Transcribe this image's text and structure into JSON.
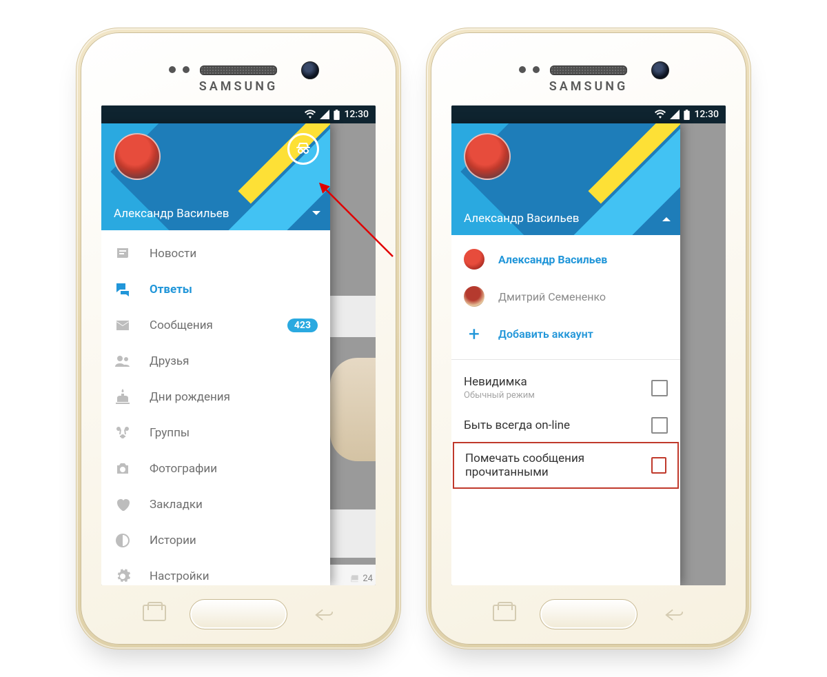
{
  "brand": "SAMSUNG",
  "status_time": "12:30",
  "user_name": "Александр Васильев",
  "nav": [
    {
      "key": "news",
      "label": "Новости"
    },
    {
      "key": "replies",
      "label": "Ответы"
    },
    {
      "key": "messages",
      "label": "Сообщения",
      "badge": "423"
    },
    {
      "key": "friends",
      "label": "Друзья"
    },
    {
      "key": "birthdays",
      "label": "Дни рождения"
    },
    {
      "key": "groups",
      "label": "Группы"
    },
    {
      "key": "photos",
      "label": "Фотографии"
    },
    {
      "key": "bookmarks",
      "label": "Закладки"
    },
    {
      "key": "stories",
      "label": "Истории"
    },
    {
      "key": "settings",
      "label": "Настройки"
    }
  ],
  "accounts": {
    "primary": "Александр Васильев",
    "secondary": "Дмитрий Семененко",
    "add_label": "Добавить аккаунт"
  },
  "options": {
    "invisible": {
      "title": "Невидимка",
      "subtitle": "Обычный режим"
    },
    "always_online": {
      "title": "Быть всегда on-line"
    },
    "mark_read": {
      "title": "Помечать сообщения прочитанными"
    }
  },
  "bg_count": "24"
}
